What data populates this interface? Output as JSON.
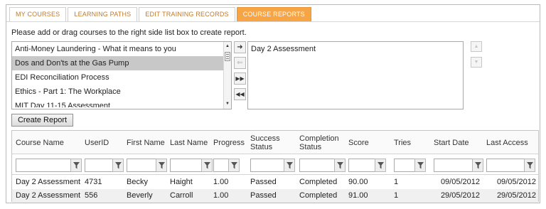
{
  "tabs": [
    {
      "label": "MY COURSES",
      "active": false
    },
    {
      "label": "LEARNING PATHS",
      "active": false
    },
    {
      "label": "EDIT TRAINING RECORDS",
      "active": false
    },
    {
      "label": "COURSE REPORTS",
      "active": true
    }
  ],
  "instructions": "Please add or drag courses to the right side list box to create report.",
  "available_courses": [
    "Anti-Money Laundering - What it means to you",
    "Dos and Don'ts at the Gas Pump",
    "EDI Reconciliation Process",
    "Ethics - Part 1: The Workplace",
    "MIT Day 11-15 Assessment"
  ],
  "selected_available_index": 1,
  "selected_courses": [
    "Day 2 Assessment"
  ],
  "icons": {
    "add": "arrow-right-icon",
    "remove": "arrow-left-icon",
    "add_all": "double-arrow-right-icon",
    "remove_all": "double-arrow-left-icon",
    "move_up": "triangle-up-icon",
    "move_down": "triangle-down-icon",
    "filter": "funnel-icon"
  },
  "create_report_label": "Create Report",
  "grid": {
    "columns": [
      {
        "key": "course",
        "label": "Course Name"
      },
      {
        "key": "user",
        "label": "UserID"
      },
      {
        "key": "first",
        "label": "First Name"
      },
      {
        "key": "last",
        "label": "Last Name"
      },
      {
        "key": "progress",
        "label": "Progress"
      },
      {
        "key": "success",
        "label": "Success Status"
      },
      {
        "key": "completion",
        "label": "Completion Status"
      },
      {
        "key": "score",
        "label": "Score"
      },
      {
        "key": "tries",
        "label": "Tries"
      },
      {
        "key": "start",
        "label": "Start Date"
      },
      {
        "key": "access",
        "label": "Last Access"
      }
    ],
    "rows": [
      [
        "Day 2 Assessment",
        "4731",
        "Becky",
        "Haight",
        "1.00",
        "Passed",
        "Completed",
        "90.00",
        "1",
        "09/05/2012",
        "09/05/2012"
      ],
      [
        "Day 2 Assessment",
        "556",
        "Beverly",
        "Carroll",
        "1.00",
        "Passed",
        "Completed",
        "91.00",
        "1",
        "29/05/2012",
        "29/05/2012"
      ]
    ]
  },
  "colors": {
    "active_tab": "#f7a444",
    "tab_text": "#c07a2c",
    "selected_item": "#c8c8c8"
  }
}
